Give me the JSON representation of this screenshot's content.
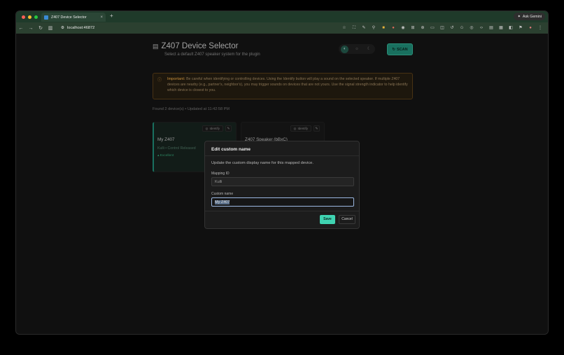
{
  "browser": {
    "tab_title": "Z407 Device Selector",
    "tab_close": "×",
    "new_tab": "+",
    "gemini_label": "Ask Gemini",
    "url": "localhost:46872"
  },
  "header": {
    "title": "Z407 Device Selector",
    "subtitle": "Select a default Z407 speaker system for the plugin",
    "scan_label": "SCAN"
  },
  "warning": {
    "strong": "Important:",
    "text": " Be careful when identifying or controlling devices. Using the Identify button will play a sound on the selected speaker. If multiple Z407 devices are nearby (e.g., partner's, neighbor's), you may trigger sounds on devices that are not yours. Use the signal strength indicator to help identify which device is closest to you."
  },
  "status": {
    "found_text": "Found 2 device(s) • Updated at 11:42:58 PM"
  },
  "devices": [
    {
      "name": "My Z407",
      "identify_label": "Identify",
      "sub": "Kulli • Control Released",
      "signal": "Excellent"
    },
    {
      "name": "Z407 Speaker (bBxC)",
      "identify_label": "Identify"
    }
  ],
  "modal": {
    "title": "Edit custom name",
    "description": "Update the custom display name for this mapped device.",
    "mapping_label": "Mapping ID",
    "mapping_value": "Kulli",
    "custom_label": "Custom name",
    "custom_value": "My Z407",
    "save_label": "Save",
    "cancel_label": "Cancel"
  }
}
